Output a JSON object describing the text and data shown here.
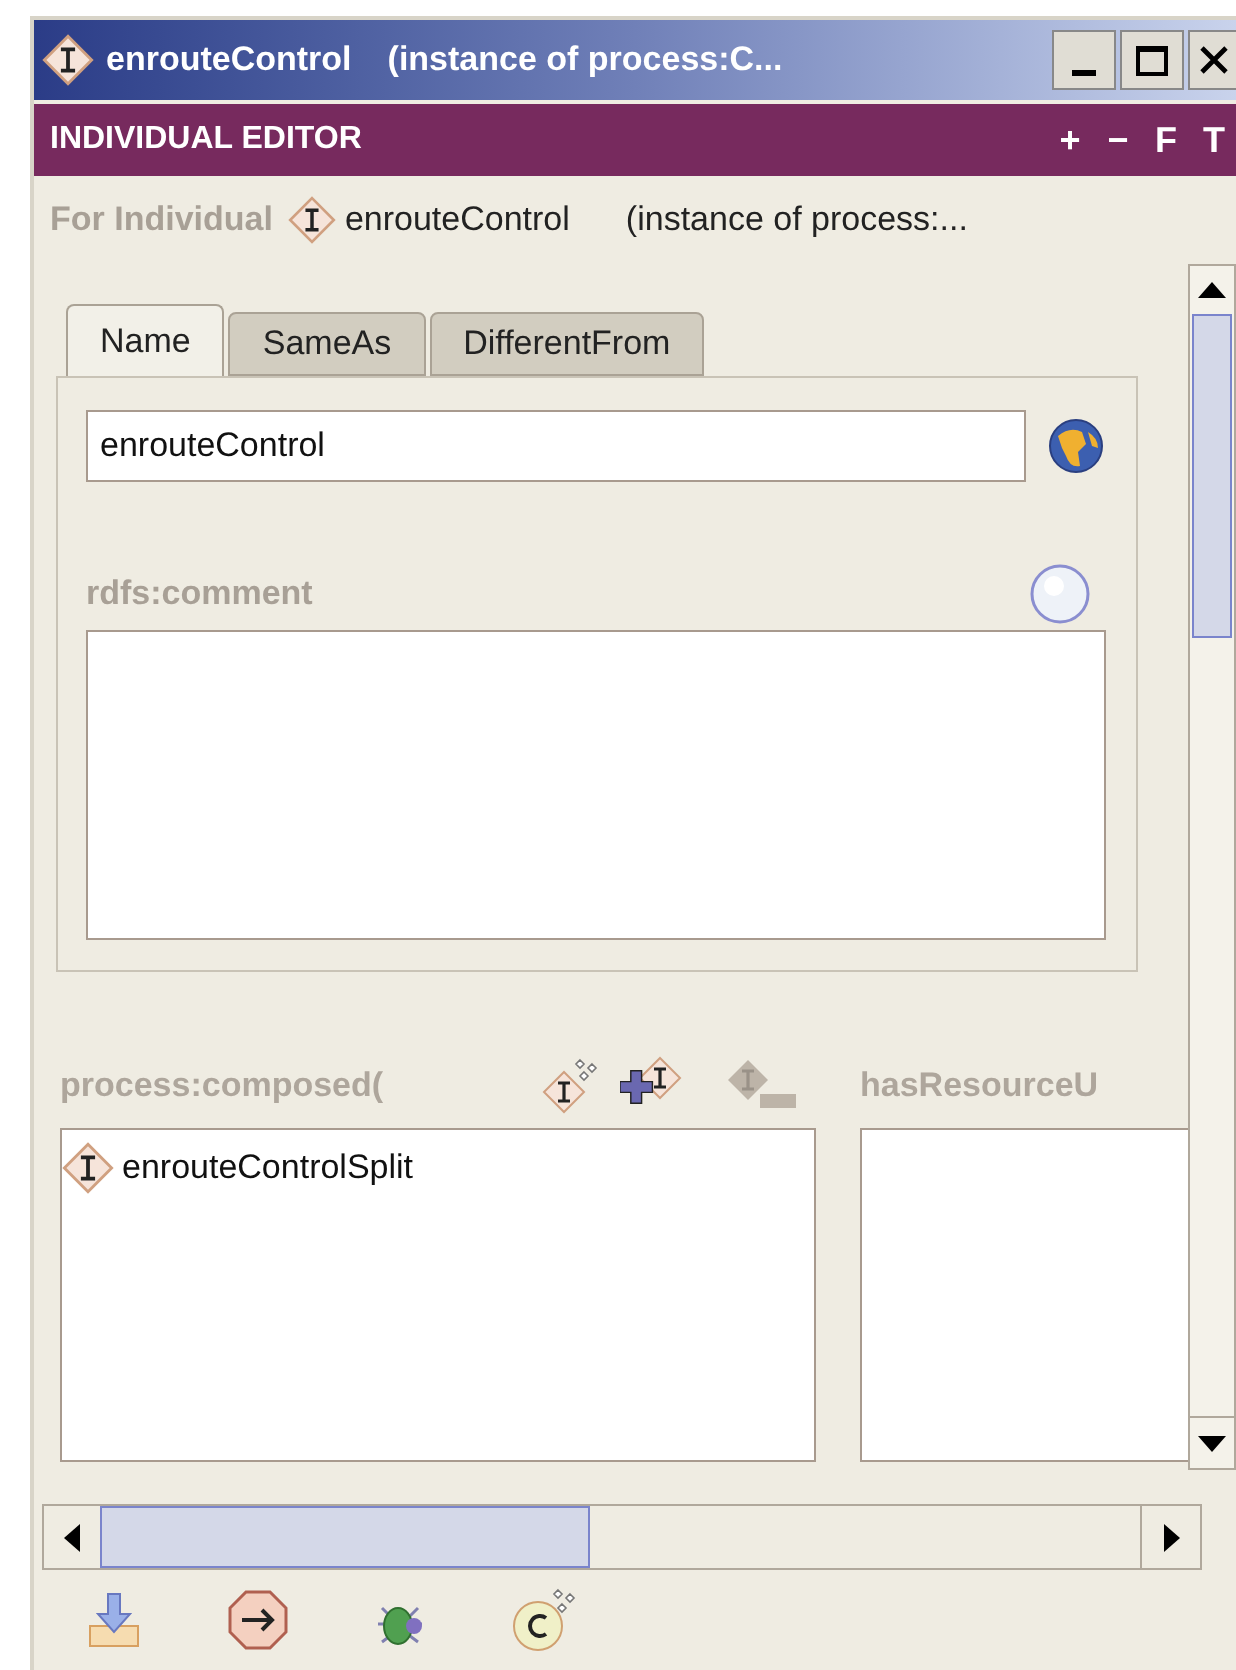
{
  "window": {
    "title": "enrouteControl",
    "title_suffix": "(instance of process:C..."
  },
  "editor_bar": {
    "title": "INDIVIDUAL EDITOR",
    "actions": [
      "+",
      "−",
      "F",
      "T"
    ]
  },
  "for_individual": {
    "label": "For Individual",
    "name": "enrouteControl",
    "type": "(instance of process:..."
  },
  "tabs": [
    {
      "label": "Name",
      "selected": true
    },
    {
      "label": "SameAs",
      "selected": false
    },
    {
      "label": "DifferentFrom",
      "selected": false
    }
  ],
  "name_field": {
    "value": "enrouteControl"
  },
  "comment": {
    "label": "rdfs:comment"
  },
  "slots": [
    {
      "label": "process:composed(",
      "items": [
        "enrouteControlSplit"
      ]
    },
    {
      "label": "hasResourceU"
    }
  ]
}
